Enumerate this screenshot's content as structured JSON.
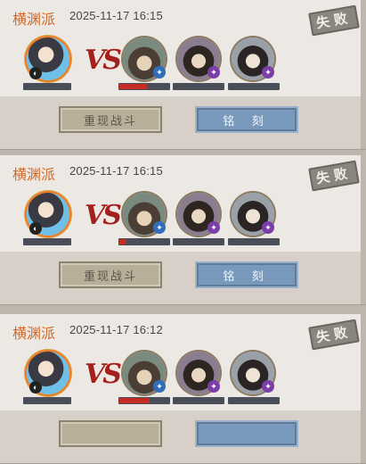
{
  "records": [
    {
      "sect": "横渊派",
      "datetime": "2025-11-17 16:15",
      "result": "失败",
      "vs": "VS",
      "player_hp_ratio": 0.0,
      "enemies": [
        {
          "hp_ratio": 0.55,
          "badge_icon": "water-element-icon"
        },
        {
          "hp_ratio": 0.0,
          "badge_icon": "purple-element-icon"
        },
        {
          "hp_ratio": 0.0,
          "badge_icon": "purple-element-icon"
        }
      ],
      "replay_label": "重现战斗",
      "engrave_label": "铭 刻"
    },
    {
      "sect": "横渊派",
      "datetime": "2025-11-17 16:15",
      "result": "失败",
      "vs": "VS",
      "player_hp_ratio": 0.0,
      "enemies": [
        {
          "hp_ratio": 0.15,
          "badge_icon": "water-element-icon"
        },
        {
          "hp_ratio": 0.0,
          "badge_icon": "purple-element-icon"
        },
        {
          "hp_ratio": 0.0,
          "badge_icon": "purple-element-icon"
        }
      ],
      "replay_label": "重现战斗",
      "engrave_label": "铭 刻"
    },
    {
      "sect": "横渊派",
      "datetime": "2025-11-17 16:12",
      "result": "失败",
      "vs": "VS",
      "player_hp_ratio": 0.0,
      "enemies": [
        {
          "hp_ratio": 0.6,
          "badge_icon": "water-element-icon"
        },
        {
          "hp_ratio": 0.0,
          "badge_icon": "purple-element-icon"
        },
        {
          "hp_ratio": 0.0,
          "badge_icon": "purple-element-icon"
        }
      ],
      "replay_label": "",
      "engrave_label": ""
    }
  ],
  "colors": {
    "sect_text": "#d06a2a",
    "hp_fill": "#c42b23",
    "vs_red": "#a4201c",
    "engrave_button": "#7899bc",
    "replay_button": "#b8ae9a"
  }
}
